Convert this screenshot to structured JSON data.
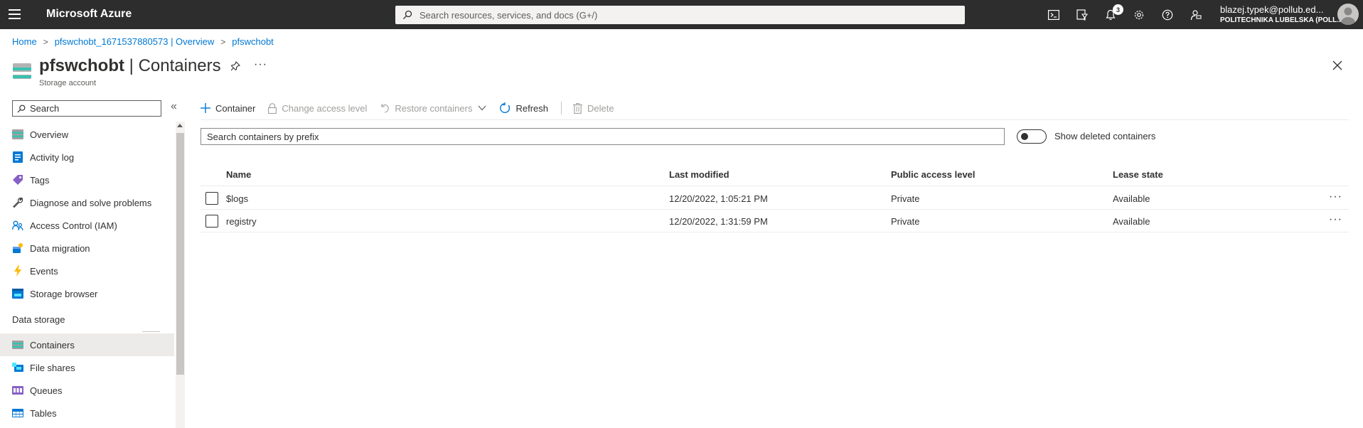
{
  "app": {
    "brand": "Microsoft Azure",
    "global_search_placeholder": "Search resources, services, and docs (G+/)",
    "notifications_count": "3",
    "account_email": "blazej.typek@pollub.ed...",
    "account_org": "POLITECHNIKA LUBELSKA (POLL...",
    "accent_color": "#0078d4",
    "topbar_color": "#2d2d2d"
  },
  "topbar_icons": [
    "cloud-shell-icon",
    "directory-filter-icon",
    "notifications-icon",
    "settings-icon",
    "help-icon",
    "feedback-icon"
  ],
  "breadcrumb": {
    "items": [
      "Home",
      "pfswchobt_1671537880573 | Overview",
      "pfswchobt"
    ]
  },
  "page": {
    "resource_name": "pfswchobt",
    "title_suffix": " | Containers",
    "subtitle": "Storage account",
    "more_label": "···"
  },
  "sidebar": {
    "search_placeholder": "Search",
    "collapse_label": "«",
    "items": [
      {
        "label": "Overview",
        "icon": "storage-account-icon"
      },
      {
        "label": "Activity log",
        "icon": "activity-log-icon"
      },
      {
        "label": "Tags",
        "icon": "tag-icon"
      },
      {
        "label": "Diagnose and solve problems",
        "icon": "wrench-icon"
      },
      {
        "label": "Access Control (IAM)",
        "icon": "people-icon"
      },
      {
        "label": "Data migration",
        "icon": "data-migration-icon"
      },
      {
        "label": "Events",
        "icon": "lightning-icon"
      },
      {
        "label": "Storage browser",
        "icon": "storage-browser-icon"
      }
    ],
    "section_title": "Data storage",
    "section_items": [
      {
        "label": "Containers",
        "icon": "containers-icon",
        "active": true
      },
      {
        "label": "File shares",
        "icon": "file-shares-icon"
      },
      {
        "label": "Queues",
        "icon": "queues-icon"
      },
      {
        "label": "Tables",
        "icon": "tables-icon"
      }
    ]
  },
  "toolbar": {
    "container_label": "Container",
    "change_access_label": "Change access level",
    "restore_label": "Restore containers",
    "refresh_label": "Refresh",
    "delete_label": "Delete"
  },
  "filters": {
    "prefix_placeholder": "Search containers by prefix",
    "show_deleted_label": "Show deleted containers",
    "show_deleted_on": false
  },
  "table": {
    "columns": [
      "Name",
      "Last modified",
      "Public access level",
      "Lease state"
    ],
    "rows": [
      {
        "name": "$logs",
        "last_modified": "12/20/2022, 1:05:21 PM",
        "access": "Private",
        "lease": "Available"
      },
      {
        "name": "registry",
        "last_modified": "12/20/2022, 1:31:59 PM",
        "access": "Private",
        "lease": "Available"
      }
    ],
    "row_more": "···"
  }
}
